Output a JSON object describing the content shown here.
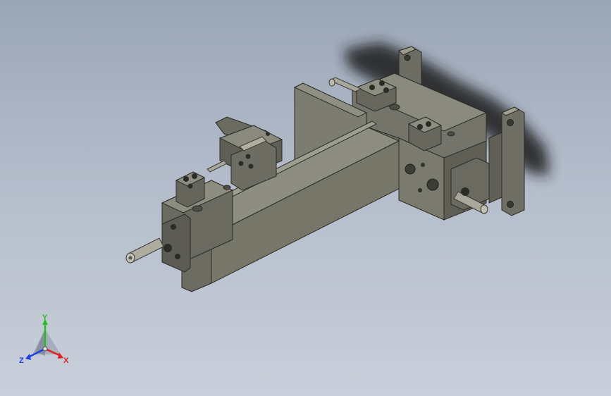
{
  "viewport": {
    "background_top": "#9aa6b6",
    "background_bottom": "#c9cfda"
  },
  "model": {
    "body_color": "#7a7a6e",
    "shadow_color": "#2a2a2a"
  },
  "triad": {
    "x_label": "X",
    "y_label": "Y",
    "z_label": "Z",
    "x_color": "#e02020",
    "y_color": "#20c020",
    "z_color": "#2040e0"
  }
}
